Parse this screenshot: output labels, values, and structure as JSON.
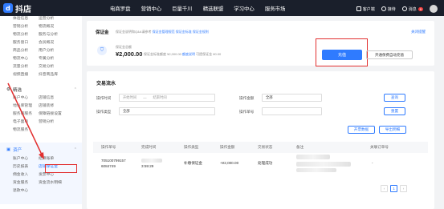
{
  "app": {
    "logo_text": "抖店",
    "logo_glyph": "d"
  },
  "topnav": {
    "items": [
      "电商罗盘",
      "营销中心",
      "巨量千川",
      "精选联盟",
      "学习中心",
      "服务市场"
    ],
    "tools": {
      "customer": "客户端",
      "agent": "接待",
      "message": "消息",
      "message_badge": "9"
    }
  },
  "sidebar": {
    "top_grid": [
      [
        "体验信息",
        "运营分析"
      ],
      [
        "营销分析",
        "物流概况"
      ],
      [
        "物流分析",
        "服务与分析"
      ],
      [
        "服务窗口",
        "会员概况"
      ],
      [
        "商品分析",
        "用户分析"
      ],
      [
        "物流中心",
        "专属分析"
      ],
      [
        "流量分析",
        "交易分析"
      ],
      [
        "视频直播",
        "抖音商品库"
      ]
    ],
    "section_shop": {
      "label": "精选",
      "chevron": "⌃"
    },
    "shop_grid": [
      [
        "账户中心",
        "店铺信息"
      ],
      [
        "地址库管理",
        "店铺装修"
      ],
      [
        "服务商服务",
        "保障链接设置"
      ],
      [
        "电子面单",
        "营销分析"
      ],
      [
        "物流服务",
        ""
      ]
    ],
    "section_assets": {
      "label": "资产",
      "chevron": "⌃"
    },
    "assets_grid": [
      [
        "账户中心",
        "结算账单"
      ],
      [
        "历史报表",
        "店铺保证金"
      ],
      [
        "佣金收入",
        "发票中心"
      ],
      [
        "资金服务",
        "资金流水明细"
      ],
      [
        "退款中心",
        ""
      ]
    ]
  },
  "deposit": {
    "title": "保证金",
    "subtitle": "保证金说明和Q&A请参考",
    "links": [
      "保证金管理规范",
      "保证金标准",
      "保证金规则"
    ],
    "guide": "关闭提醒",
    "balance_label": "保证金总额",
    "amount": "¥2,000.00",
    "detail_prefix": "保证金标准额度 ¥2,000.00",
    "detail_link": "额度说明",
    "detail_suffix": "可提保证金 ¥0.00",
    "recharge_btn": "充值",
    "autopay_btn": "开通保费自动充值"
  },
  "flow": {
    "title": "交易流水",
    "filters": {
      "time_label": "操作时间",
      "time_start": "开始时间",
      "time_sep": "—",
      "time_end": "结束时间",
      "all_label": "操作金额",
      "all_value": "全部",
      "type_label": "操作类型",
      "type_value": "全部",
      "order_label": "操作单号",
      "order_value": ""
    },
    "query_btn": "查询",
    "reset_btn": "重置",
    "export_btn": "开票数据",
    "download_btn": "导出明细",
    "columns": [
      "操作单号",
      "完成时间",
      "操作类型",
      "操作金额",
      "交易状态",
      "备注",
      "关联订单号"
    ],
    "rows": [
      {
        "order_line1": "705100799157",
        "order_line2": "6084749",
        "time": "3:59:29",
        "type": "补缴保证金",
        "amount": "+¥2,000.00",
        "status": "处理成功",
        "related": "-"
      }
    ],
    "pager": {
      "prev": "‹",
      "current": "1",
      "next": "›"
    }
  }
}
